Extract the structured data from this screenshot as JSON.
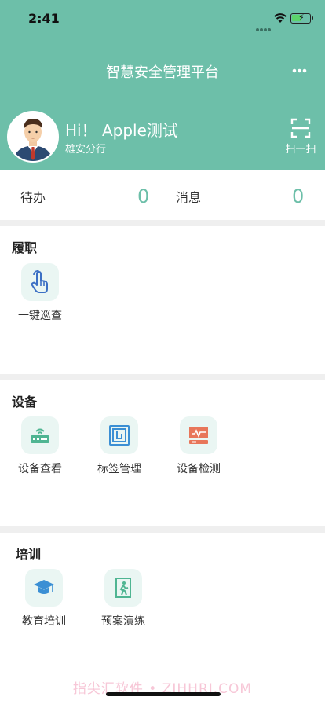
{
  "status_bar": {
    "time": "2:41"
  },
  "header": {
    "title": "智慧安全管理平台",
    "more_icon": "ellipsis-icon",
    "greeting": "Hi！ Apple测试",
    "branch": "雄安分行",
    "scan_label": "扫一扫",
    "bg_color": "#6dbfa9"
  },
  "summary": {
    "todo_label": "待办",
    "todo_count": "0",
    "message_label": "消息",
    "message_count": "0"
  },
  "sections": {
    "duty": {
      "title": "履职",
      "items": [
        {
          "label": "一键巡查",
          "icon": "tap-hand-icon"
        }
      ]
    },
    "device": {
      "title": "设备",
      "items": [
        {
          "label": "设备查看",
          "icon": "router-icon"
        },
        {
          "label": "标签管理",
          "icon": "tag-icon"
        },
        {
          "label": "设备检测",
          "icon": "monitor-icon"
        }
      ]
    },
    "training": {
      "title": "培训",
      "items": [
        {
          "label": "教育培训",
          "icon": "graduation-cap-icon"
        },
        {
          "label": "预案演练",
          "icon": "emergency-exit-icon"
        }
      ]
    }
  },
  "watermark": "指尖汇软件 • ZJHHRJ.COM"
}
